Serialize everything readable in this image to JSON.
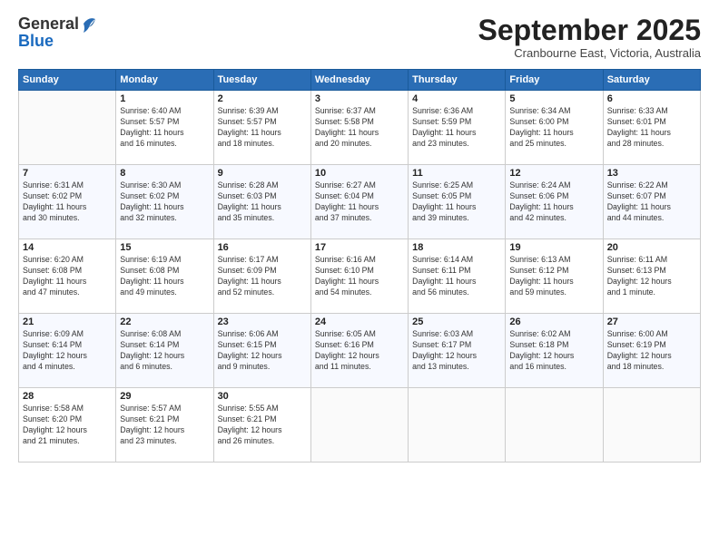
{
  "header": {
    "logo_general": "General",
    "logo_blue": "Blue",
    "month_title": "September 2025",
    "subtitle": "Cranbourne East, Victoria, Australia"
  },
  "weekdays": [
    "Sunday",
    "Monday",
    "Tuesday",
    "Wednesday",
    "Thursday",
    "Friday",
    "Saturday"
  ],
  "weeks": [
    [
      {
        "day": "",
        "info": ""
      },
      {
        "day": "1",
        "info": "Sunrise: 6:40 AM\nSunset: 5:57 PM\nDaylight: 11 hours\nand 16 minutes."
      },
      {
        "day": "2",
        "info": "Sunrise: 6:39 AM\nSunset: 5:57 PM\nDaylight: 11 hours\nand 18 minutes."
      },
      {
        "day": "3",
        "info": "Sunrise: 6:37 AM\nSunset: 5:58 PM\nDaylight: 11 hours\nand 20 minutes."
      },
      {
        "day": "4",
        "info": "Sunrise: 6:36 AM\nSunset: 5:59 PM\nDaylight: 11 hours\nand 23 minutes."
      },
      {
        "day": "5",
        "info": "Sunrise: 6:34 AM\nSunset: 6:00 PM\nDaylight: 11 hours\nand 25 minutes."
      },
      {
        "day": "6",
        "info": "Sunrise: 6:33 AM\nSunset: 6:01 PM\nDaylight: 11 hours\nand 28 minutes."
      }
    ],
    [
      {
        "day": "7",
        "info": "Sunrise: 6:31 AM\nSunset: 6:02 PM\nDaylight: 11 hours\nand 30 minutes."
      },
      {
        "day": "8",
        "info": "Sunrise: 6:30 AM\nSunset: 6:02 PM\nDaylight: 11 hours\nand 32 minutes."
      },
      {
        "day": "9",
        "info": "Sunrise: 6:28 AM\nSunset: 6:03 PM\nDaylight: 11 hours\nand 35 minutes."
      },
      {
        "day": "10",
        "info": "Sunrise: 6:27 AM\nSunset: 6:04 PM\nDaylight: 11 hours\nand 37 minutes."
      },
      {
        "day": "11",
        "info": "Sunrise: 6:25 AM\nSunset: 6:05 PM\nDaylight: 11 hours\nand 39 minutes."
      },
      {
        "day": "12",
        "info": "Sunrise: 6:24 AM\nSunset: 6:06 PM\nDaylight: 11 hours\nand 42 minutes."
      },
      {
        "day": "13",
        "info": "Sunrise: 6:22 AM\nSunset: 6:07 PM\nDaylight: 11 hours\nand 44 minutes."
      }
    ],
    [
      {
        "day": "14",
        "info": "Sunrise: 6:20 AM\nSunset: 6:08 PM\nDaylight: 11 hours\nand 47 minutes."
      },
      {
        "day": "15",
        "info": "Sunrise: 6:19 AM\nSunset: 6:08 PM\nDaylight: 11 hours\nand 49 minutes."
      },
      {
        "day": "16",
        "info": "Sunrise: 6:17 AM\nSunset: 6:09 PM\nDaylight: 11 hours\nand 52 minutes."
      },
      {
        "day": "17",
        "info": "Sunrise: 6:16 AM\nSunset: 6:10 PM\nDaylight: 11 hours\nand 54 minutes."
      },
      {
        "day": "18",
        "info": "Sunrise: 6:14 AM\nSunset: 6:11 PM\nDaylight: 11 hours\nand 56 minutes."
      },
      {
        "day": "19",
        "info": "Sunrise: 6:13 AM\nSunset: 6:12 PM\nDaylight: 11 hours\nand 59 minutes."
      },
      {
        "day": "20",
        "info": "Sunrise: 6:11 AM\nSunset: 6:13 PM\nDaylight: 12 hours\nand 1 minute."
      }
    ],
    [
      {
        "day": "21",
        "info": "Sunrise: 6:09 AM\nSunset: 6:14 PM\nDaylight: 12 hours\nand 4 minutes."
      },
      {
        "day": "22",
        "info": "Sunrise: 6:08 AM\nSunset: 6:14 PM\nDaylight: 12 hours\nand 6 minutes."
      },
      {
        "day": "23",
        "info": "Sunrise: 6:06 AM\nSunset: 6:15 PM\nDaylight: 12 hours\nand 9 minutes."
      },
      {
        "day": "24",
        "info": "Sunrise: 6:05 AM\nSunset: 6:16 PM\nDaylight: 12 hours\nand 11 minutes."
      },
      {
        "day": "25",
        "info": "Sunrise: 6:03 AM\nSunset: 6:17 PM\nDaylight: 12 hours\nand 13 minutes."
      },
      {
        "day": "26",
        "info": "Sunrise: 6:02 AM\nSunset: 6:18 PM\nDaylight: 12 hours\nand 16 minutes."
      },
      {
        "day": "27",
        "info": "Sunrise: 6:00 AM\nSunset: 6:19 PM\nDaylight: 12 hours\nand 18 minutes."
      }
    ],
    [
      {
        "day": "28",
        "info": "Sunrise: 5:58 AM\nSunset: 6:20 PM\nDaylight: 12 hours\nand 21 minutes."
      },
      {
        "day": "29",
        "info": "Sunrise: 5:57 AM\nSunset: 6:21 PM\nDaylight: 12 hours\nand 23 minutes."
      },
      {
        "day": "30",
        "info": "Sunrise: 5:55 AM\nSunset: 6:21 PM\nDaylight: 12 hours\nand 26 minutes."
      },
      {
        "day": "",
        "info": ""
      },
      {
        "day": "",
        "info": ""
      },
      {
        "day": "",
        "info": ""
      },
      {
        "day": "",
        "info": ""
      }
    ]
  ]
}
